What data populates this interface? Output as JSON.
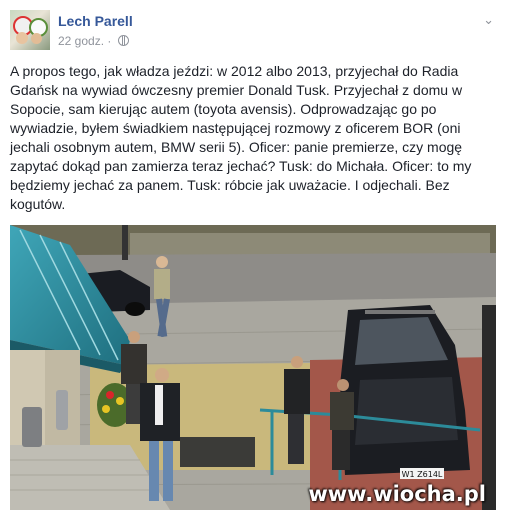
{
  "post": {
    "author": "Lech Parell",
    "time": "22 godz.",
    "separator": "·",
    "privacy_icon": "globe-icon",
    "menu_icon": "chevron-down-icon",
    "text": "A propos tego, jak władza jeździ: w 2012 albo 2013, przyjechał do Radia Gdańsk na wywiad ówczesny premier Donald Tusk. Przyjechał z domu w Sopocie, sam kierując autem (toyota avensis). Odprowadzając go po wywiadzie, byłem świadkiem następującej rozmowy z oficerem BOR (oni jechali osobnym autem, BMW serii 5). Oficer: panie premierze, czy mogę zapytać dokąd pan zamierza teraz jechać? Tusk: do Michała. Oficer: to my będziemy jechać za panem. Tusk: róbcie jak uważacie. I odjechali. Bez kogutów."
  },
  "photo": {
    "plate": "W1 Z614L",
    "watermark": "www.wiocha.pl"
  },
  "colors": {
    "author_link": "#365899",
    "meta_gray": "#90949c",
    "text": "#1d2129"
  }
}
